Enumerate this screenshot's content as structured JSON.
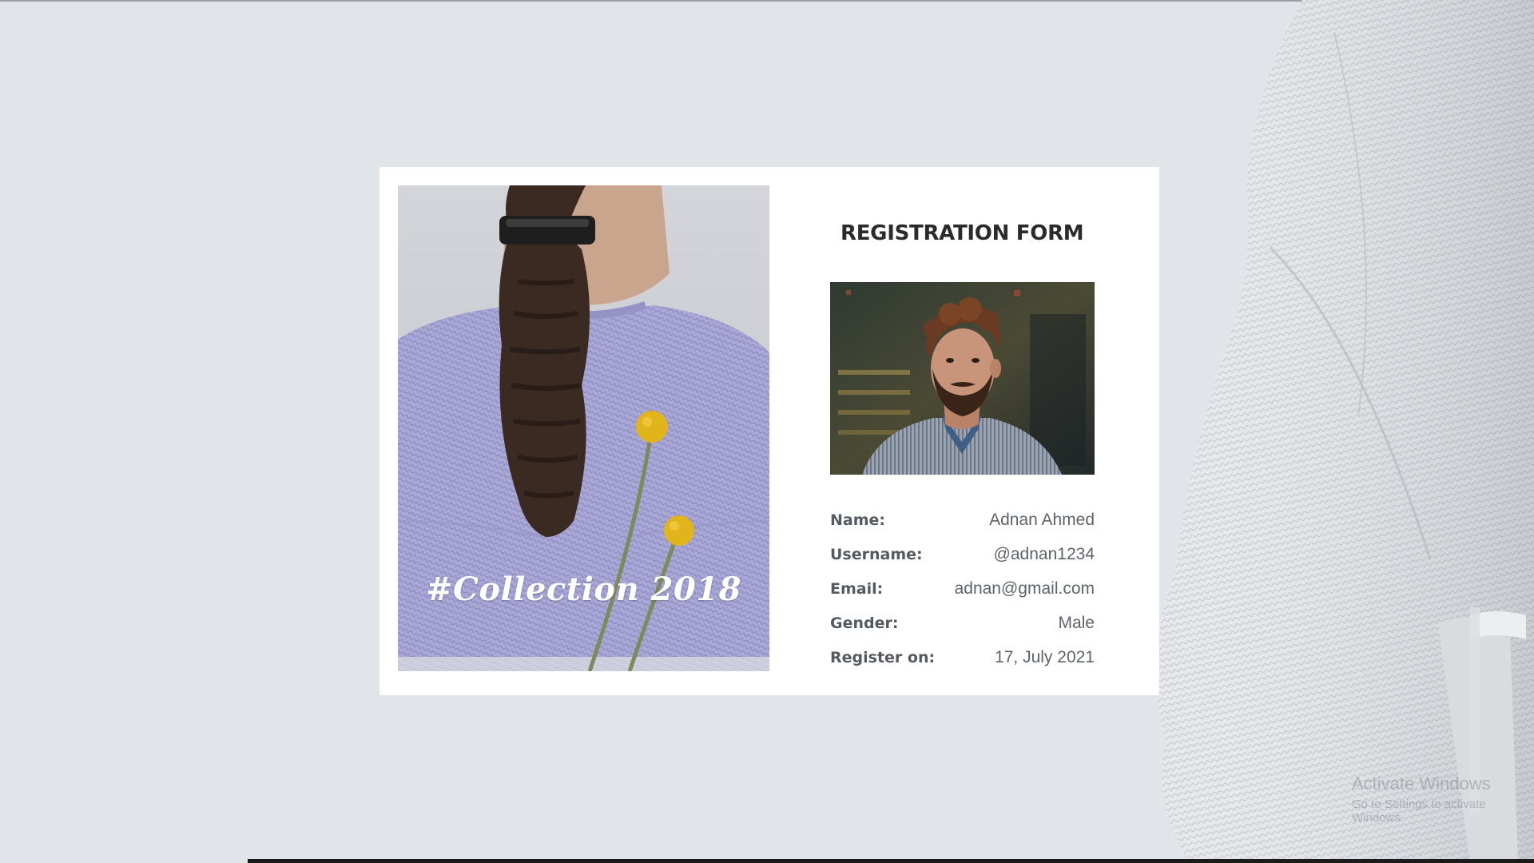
{
  "card": {
    "collection_caption": "#Collection 2018",
    "form_title": "REGISTRATION FORM",
    "fields": [
      {
        "label": "Name:",
        "value": "Adnan Ahmed"
      },
      {
        "label": "Username:",
        "value": "@adnan1234"
      },
      {
        "label": "Email:",
        "value": "adnan@gmail.com"
      },
      {
        "label": "Gender:",
        "value": "Male"
      },
      {
        "label": "Register on:",
        "value": "17, July 2021"
      }
    ]
  },
  "watermark": {
    "line1": "Activate Windows",
    "line2": "Go to Settings to activate Windows."
  },
  "colors": {
    "page_background": "#e1e5e9",
    "card_background": "#ffffff",
    "title_text": "#2b2b2b",
    "label_text": "#555a61",
    "value_text": "#5e636a",
    "sweater_lavender": "#a8a6d3"
  }
}
